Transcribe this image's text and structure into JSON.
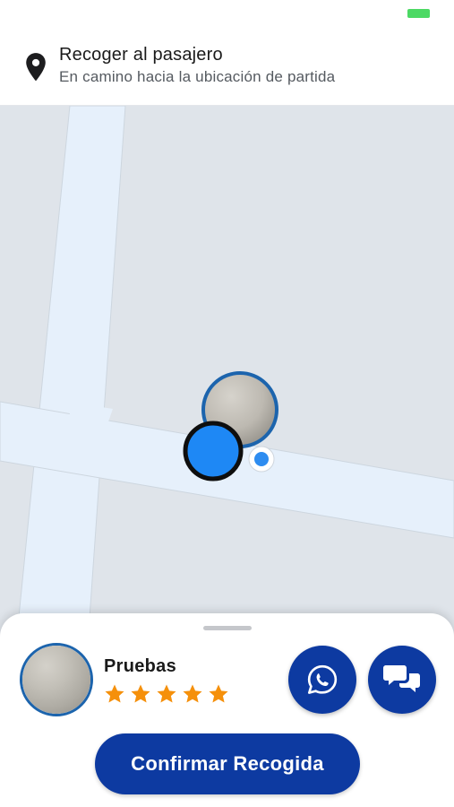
{
  "status_bar": {
    "battery_color": "#4cd964"
  },
  "header": {
    "icon": "location-pin-icon",
    "title": "Recoger al pasajero",
    "subtitle": "En camino hacia la ubicación de partida"
  },
  "map": {
    "road_color": "#e6f0fb",
    "block_color": "#dfe4ea",
    "markers": [
      "passenger-photo-marker",
      "driver-position-marker",
      "my-location-dot"
    ]
  },
  "sheet": {
    "passenger_name": "Pruebas",
    "rating": 5,
    "rating_max": 5,
    "whatsapp_icon": "whatsapp-icon",
    "chat_icon": "chat-bubbles-icon",
    "confirm_label": "Confirmar Recogida",
    "accent_color": "#0d3aa1",
    "star_color": "#f5900b"
  }
}
